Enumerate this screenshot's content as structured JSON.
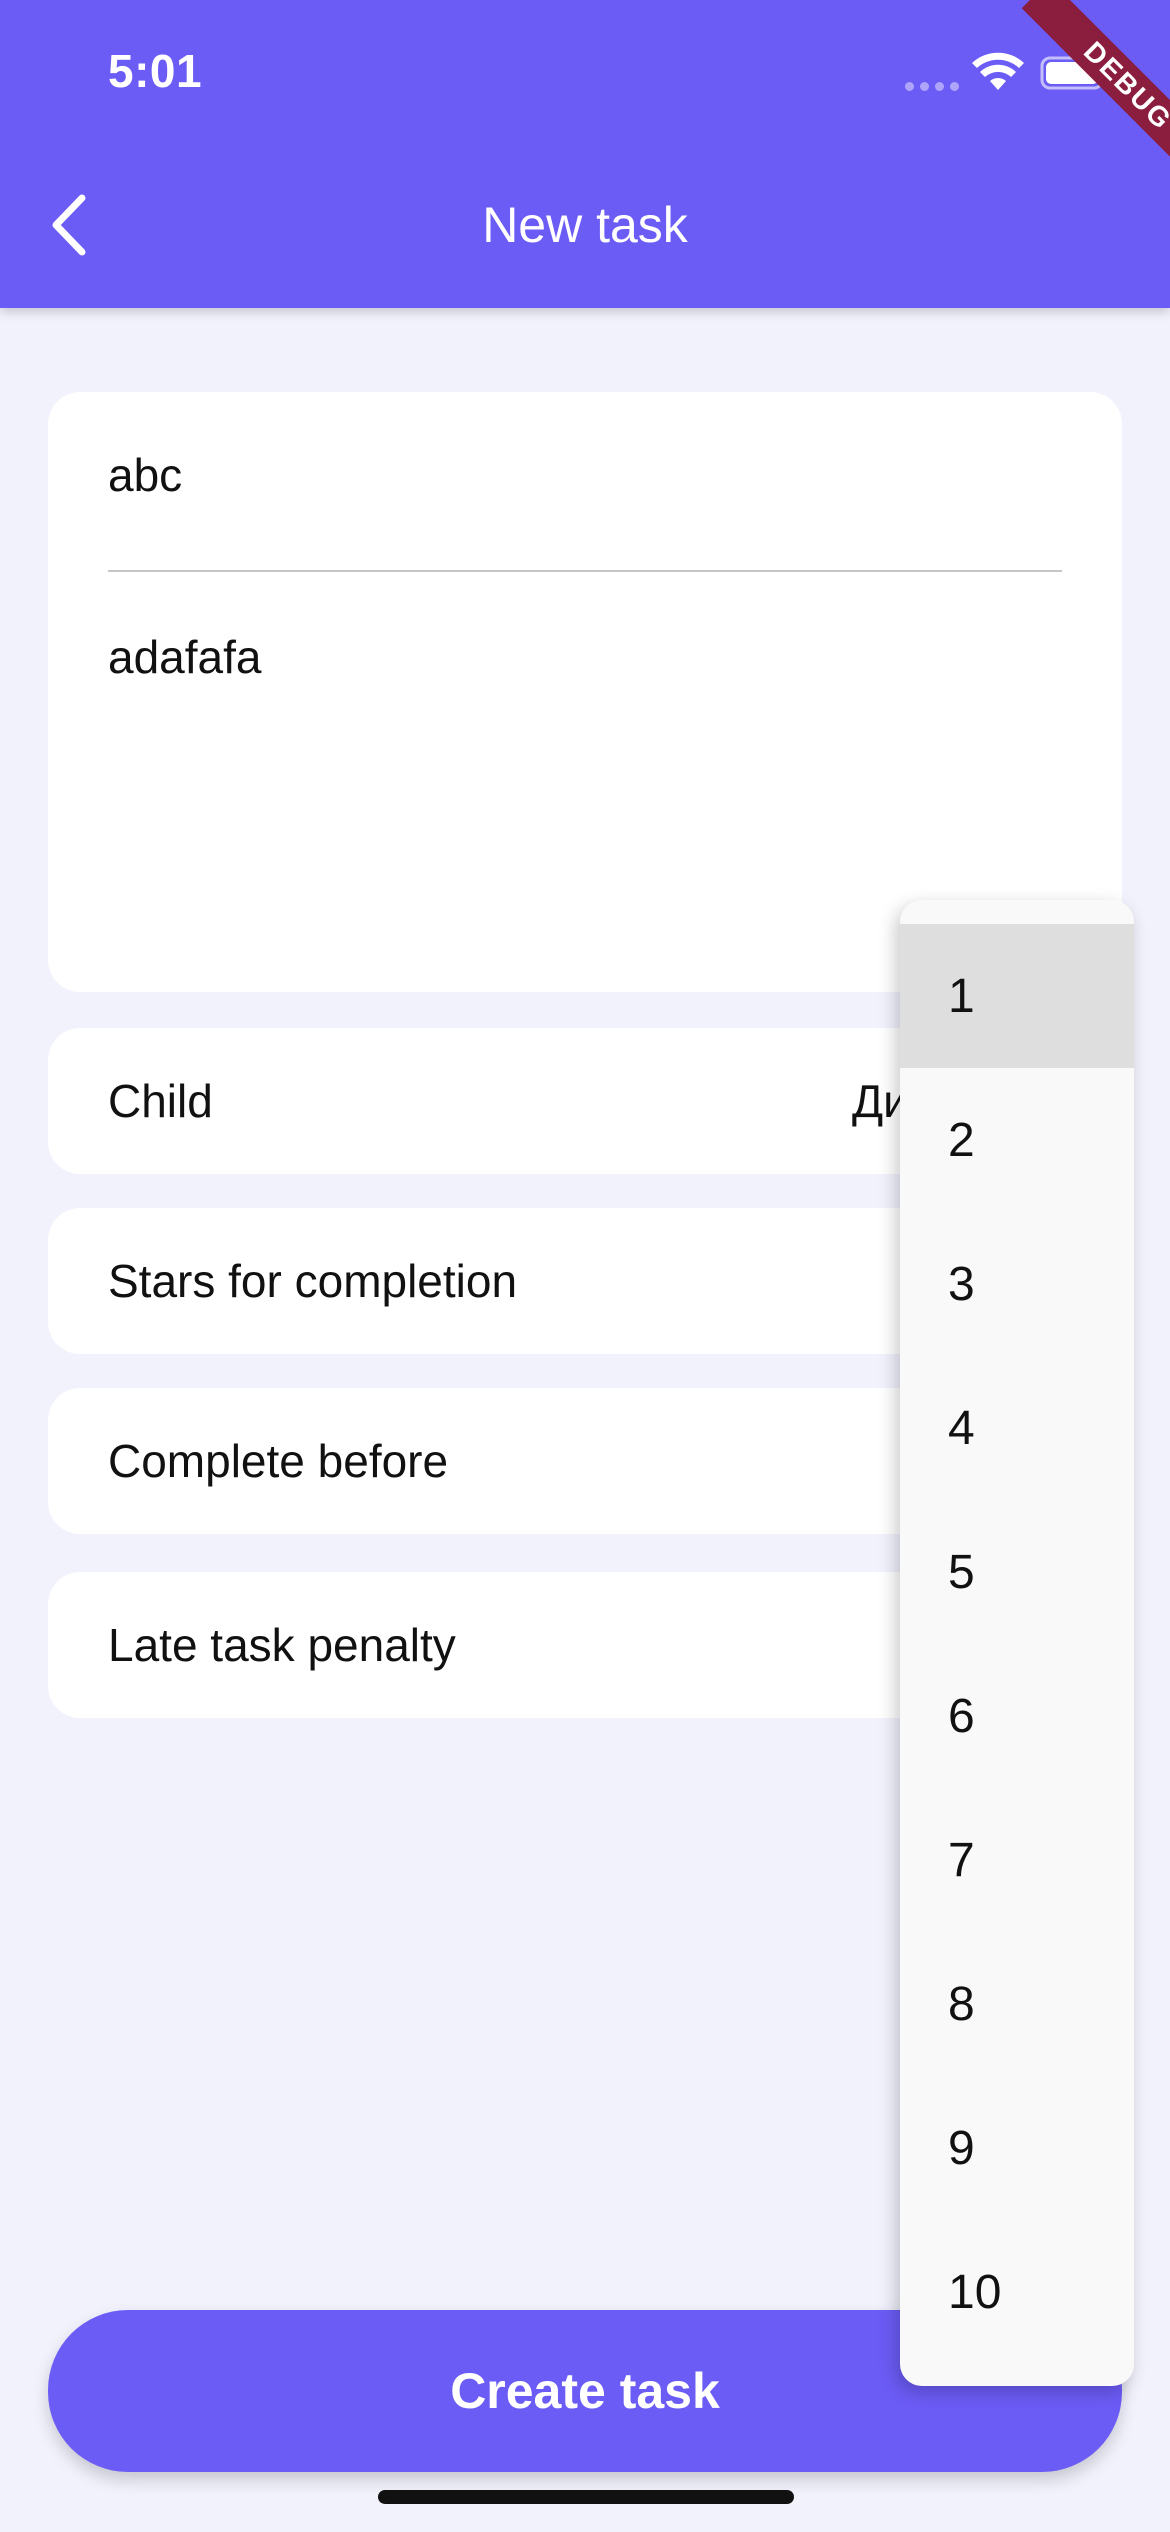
{
  "status_bar": {
    "time": "5:01"
  },
  "debug_banner": "DEBUG",
  "app_bar": {
    "title": "New task",
    "back_icon": "chevron-left-icon"
  },
  "form": {
    "title_value": "abc",
    "description_value": "adafafa",
    "rows": [
      {
        "label": "Child",
        "value": "Дина"
      },
      {
        "label": "Stars for completion",
        "value": ""
      },
      {
        "label": "Complete before",
        "value": ""
      },
      {
        "label": "Late task penalty",
        "value": ""
      }
    ]
  },
  "dropdown": {
    "selected": "1",
    "options": [
      "1",
      "2",
      "3",
      "4",
      "5",
      "6",
      "7",
      "8",
      "9",
      "10"
    ]
  },
  "create_button": {
    "label": "Create task"
  },
  "colors": {
    "primary": "#6c5cf6",
    "background": "#f2f2fd",
    "debug": "#8b1e3f"
  }
}
